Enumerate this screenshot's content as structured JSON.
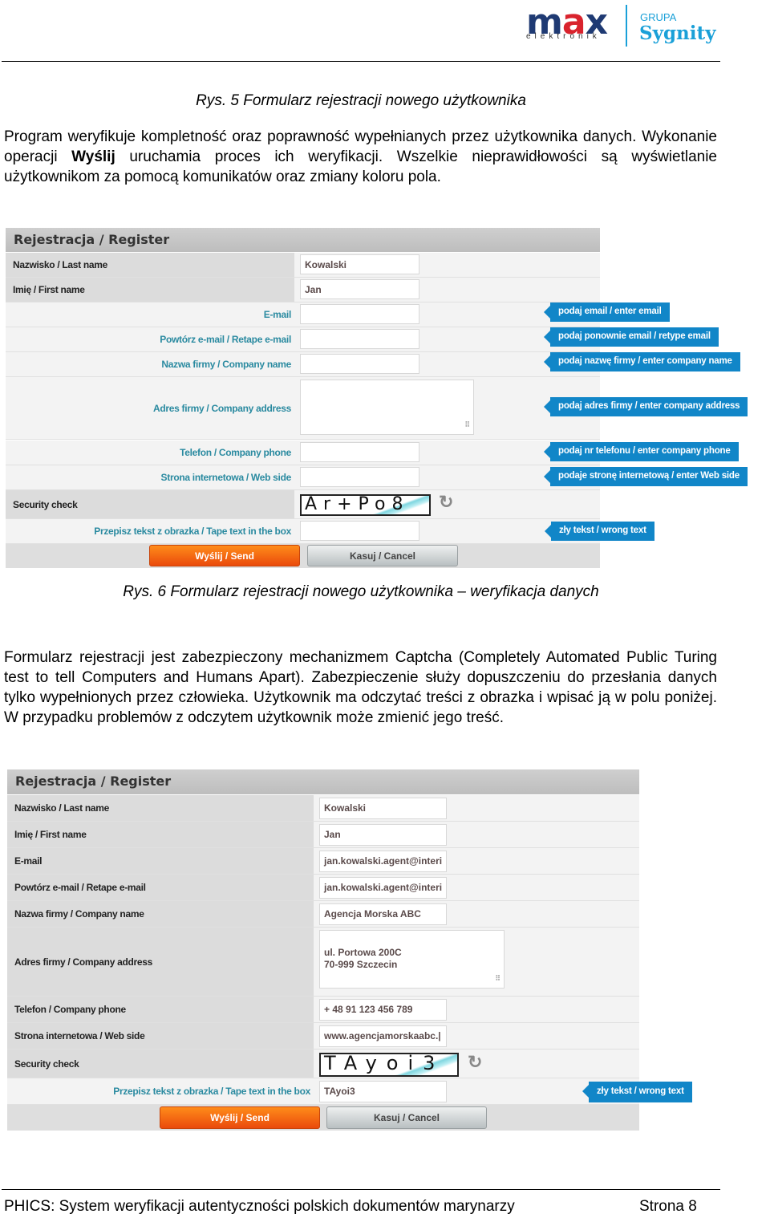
{
  "header": {
    "logo_main": "max",
    "logo_sub": "elektronik",
    "partner_prefix": "GRUPA",
    "partner_name": "Sygnity"
  },
  "captions": {
    "fig5": "Rys. 5 Formularz rejestracji nowego użytkownika",
    "fig6": "Rys. 6 Formularz rejestracji nowego użytkownika – weryfikacja danych"
  },
  "paragraphs": {
    "p1_before": "Program weryfikuje kompletność oraz poprawność wypełnianych przez użytkownika danych. Wykonanie operacji ",
    "p1_bold": "Wyślij",
    "p1_after": " uruchamia proces ich weryfikacji. Wszelkie nieprawidłowości są wyświetlanie użytkownikom za pomocą komunikatów oraz zmiany koloru pola.",
    "p2": "Formularz rejestracji jest zabezpieczony mechanizmem Captcha (Completely Automated Public Turing test to tell Computers and Humans Apart). Zabezpieczenie służy dopuszczeniu do przesłania danych tylko wypełnionych przez człowieka. Użytkownik ma odczytać treści z obrazka i wpisać ją w polu poniżej. W przypadku problemów z odczytem użytkownik może zmienić jego treść."
  },
  "form1": {
    "title": "Rejestracja / Register",
    "fields": {
      "last_name": {
        "label": "Nazwisko / Last name",
        "value": "Kowalski"
      },
      "first_name": {
        "label": "Imię / First name",
        "value": "Jan"
      },
      "email": {
        "label": "E-mail",
        "value": "",
        "error": "podaj email / enter email"
      },
      "email_retype": {
        "label": "Powtórz e-mail / Retape e-mail",
        "value": "",
        "error": "podaj ponownie email / retype email"
      },
      "company_name": {
        "label": "Nazwa firmy / Company name",
        "value": "",
        "error": "podaj nazwę firmy / enter company name"
      },
      "company_address": {
        "label": "Adres firmy / Company address",
        "value": "",
        "error": "podaj adres firmy / enter company address"
      },
      "phone": {
        "label": "Telefon / Company phone",
        "value": "",
        "error": "podaj nr telefonu / enter company phone"
      },
      "website": {
        "label": "Strona internetowa / Web side",
        "value": "",
        "error": "podaje stronę internetową / enter Web side"
      },
      "security": {
        "label": "Security check",
        "captcha_text": "Ar+Po8"
      },
      "captcha_input": {
        "label": "Przepisz tekst z obrazka / Tape text in the box",
        "value": "",
        "error": "zły tekst / wrong text"
      }
    },
    "send_label": "Wyślij / Send",
    "cancel_label": "Kasuj / Cancel"
  },
  "form2": {
    "title": "Rejestracja / Register",
    "fields": {
      "last_name": {
        "label": "Nazwisko / Last name",
        "value": "Kowalski"
      },
      "first_name": {
        "label": "Imię / First name",
        "value": "Jan"
      },
      "email": {
        "label": "E-mail",
        "value": "jan.kowalski.agent@interi"
      },
      "email_retype": {
        "label": "Powtórz e-mail / Retape e-mail",
        "value": "jan.kowalski.agent@interi"
      },
      "company_name": {
        "label": "Nazwa firmy / Company name",
        "value": "Agencja Morska ABC"
      },
      "company_address": {
        "label": "Adres firmy / Company address",
        "value": "ul. Portowa 200C\n70-999 Szczecin"
      },
      "phone": {
        "label": "Telefon / Company phone",
        "value": "+ 48 91 123 456 789"
      },
      "website": {
        "label": "Strona internetowa / Web side",
        "value": "www.agencjamorskaabc.|"
      },
      "security": {
        "label": "Security check",
        "captcha_text": "TAyoi3"
      },
      "captcha_input": {
        "label": "Przepisz tekst z obrazka / Tape text in the box",
        "value": "TAyoi3",
        "error": "zły tekst / wrong text"
      }
    },
    "send_label": "Wyślij / Send",
    "cancel_label": "Kasuj / Cancel"
  },
  "footer": {
    "title": "PHICS: System weryfikacji autentyczności polskich dokumentów marynarzy",
    "page": "Strona 8"
  },
  "colors": {
    "tooltip": "#1186c8",
    "send_button": "#ea4a0c",
    "label_teal": "#2a8aa0"
  }
}
